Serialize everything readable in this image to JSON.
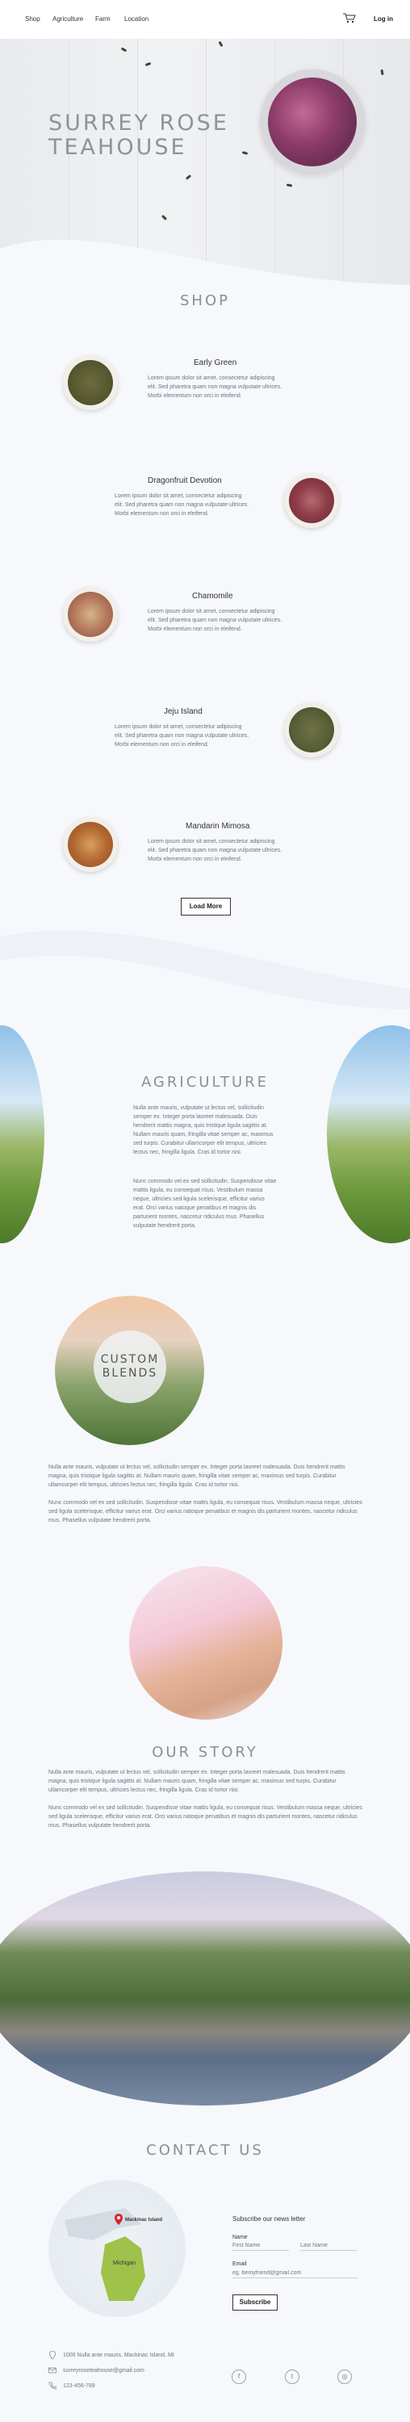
{
  "nav": {
    "links": [
      "Shop",
      "Agriculture",
      "Farm",
      "Location"
    ],
    "login": "Log in"
  },
  "hero": {
    "title_line1": "SURREY ROSE",
    "title_line2": "TEAHOUSE"
  },
  "shop": {
    "title": "SHOP",
    "items": [
      {
        "name": "Early Green",
        "desc": "Lorem ipsum dolor sit amet, consectetur adipiscing elit. Sed pharetra quam non magna vulputate ultrices. Morbi elementum non orci in eleifend."
      },
      {
        "name": "Dragonfruit Devotion",
        "desc": "Lorem ipsum dolor sit amet, consectetur adipiscing elit. Sed pharetra quam non magna vulputate ultrices. Morbi elementum non orci in eleifend."
      },
      {
        "name": "Chamomile",
        "desc": "Lorem ipsum dolor sit amet, consectetur adipiscing elit. Sed pharetra quam non magna vulputate ultrices. Morbi elementum non orci in eleifend."
      },
      {
        "name": "Jeju Island",
        "desc": "Lorem ipsum dolor sit amet, consectetur adipiscing elit. Sed pharetra quam non magna vulputate ultrices. Morbi elementum non orci in eleifend."
      },
      {
        "name": "Mandarin Mimosa",
        "desc": "Lorem ipsum dolor sit amet, consectetur adipiscing elit. Sed pharetra quam non magna vulputate ultrices. Morbi elementum non orci in eleifend."
      }
    ],
    "load_more": "Load More"
  },
  "agriculture": {
    "title": "AGRICULTURE",
    "p1": "Nulla ante mauris, vulputate ut lectus vel, sollicitudin semper ex. Integer porta laoreet malesuada. Duis hendrerit mattis magna, quis tristique ligula sagittis at. Nullam mauris quam, fringilla vitae semper ac, maximus sed turpis. Curabitur ullamcorper elit tempus, ultricies lectus nec, fringilla ligula. Cras id tortor nisi.",
    "p2": "Nunc commodo vel ex sed sollicitudin. Suspendisse vitae mattis ligula, eu consequat risus. Vestibulum massa neque, ultricies sed ligula scelerisque, efficitur varius erat. Orci varius natoque penatibus et magnis dis parturient montes, nascetur ridiculus mus. Phasellus vulputate hendrerit porta."
  },
  "blends": {
    "line1": "CUSTOM",
    "line2": "BLENDS",
    "p1": "Nulla ante mauris, vulputate ut lectus vel, sollicitudin semper ex. Integer porta laoreet malesuada. Duis hendrerit mattis magna, quis tristique ligula sagittis at. Nullam mauris quam, fringilla vitae semper ac, maximus sed turpis. Curabitur ullamcorper elit tempus, ultricies lectus nec, fringilla ligula. Cras id tortor nisi.",
    "p2": "Nunc commodo vel ex sed sollicitudin. Suspendisse vitae mattis ligula, eu consequat risus. Vestibulum massa neque, ultricies sed ligula scelerisque, efficitur varius erat. Orci varius natoque penatibus et magnis dis parturient montes, nascetur ridiculus mus. Phasellus vulputate hendrerit porta."
  },
  "story": {
    "title": "OUR STORY",
    "p1": "Nulla ante mauris, vulputate ut lectus vel, sollicitudin semper ex. Integer porta laoreet malesuada. Duis hendrerit mattis magna, quis tristique ligula sagittis at. Nullam mauris quam, fringilla vitae semper ac, maximus sed turpis. Curabitur ullamcorper elit tempus, ultricies lectus nec, fringilla ligula. Cras id tortor nisi.",
    "p2": "Nunc commodo vel ex sed sollicitudin. Suspendisse vitae mattis ligula, eu consequat risus. Vestibulum massa neque, ultricies sed ligula scelerisque, efficitur varius erat. Orci varius natoque penatibus et magnis dis parturient montes, nascetur ridiculus mus. Phasellus vulputate hendrerit porta."
  },
  "contact": {
    "title": "CONTACT US",
    "map_label1": "Mackinac Island",
    "map_label2": "Michigan",
    "newsletter_title": "Subscribe our news letter",
    "name_label": "Name",
    "first_placeholder": "First Name",
    "last_placeholder": "Last Name",
    "email_label": "Email",
    "email_placeholder": "eg. bemyfriend@gmail.com",
    "subscribe": "Subscribe",
    "address": "1000 Nulla ante mauris, Mackinac Island, MI",
    "email": "surreyroseteahouse@gmail.com",
    "phone": "123-456-789"
  },
  "colors": {
    "heading": "#8a8f96",
    "body_text": "#6a7480",
    "accent": "#222222"
  }
}
